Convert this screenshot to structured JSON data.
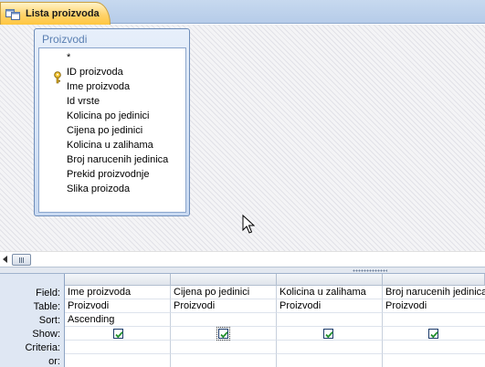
{
  "tab": {
    "label": "Lista proizvoda",
    "icon": "query-icon"
  },
  "table_box": {
    "title": "Proizvodi",
    "fields": [
      "*",
      "ID proizvoda",
      "Ime proizvoda",
      "Id vrste",
      "Kolicina po jedinici",
      "Cijena po jedinici",
      "Kolicina u zalihama",
      "Broj narucenih jedinica",
      "Prekid proizvodnje",
      "Slika proizoda"
    ],
    "primary_key_field": "ID proizvoda"
  },
  "grid": {
    "row_labels": [
      "Field:",
      "Table:",
      "Sort:",
      "Show:",
      "Criteria:",
      "or:"
    ],
    "columns": [
      {
        "field": "Ime proizvoda",
        "table": "Proizvodi",
        "sort": "Ascending",
        "show": true
      },
      {
        "field": "Cijena po jedinici",
        "table": "Proizvodi",
        "sort": "",
        "show": true
      },
      {
        "field": "Kolicina u zalihama",
        "table": "Proizvodi",
        "sort": "",
        "show": true
      },
      {
        "field": "Broj narucenih jedinica",
        "table": "Proizvodi",
        "sort": "",
        "show": true
      }
    ]
  },
  "colors": {
    "tab_active": "#ffc640",
    "table_title": "#5a7fb2",
    "check": "#1f8f2a"
  }
}
